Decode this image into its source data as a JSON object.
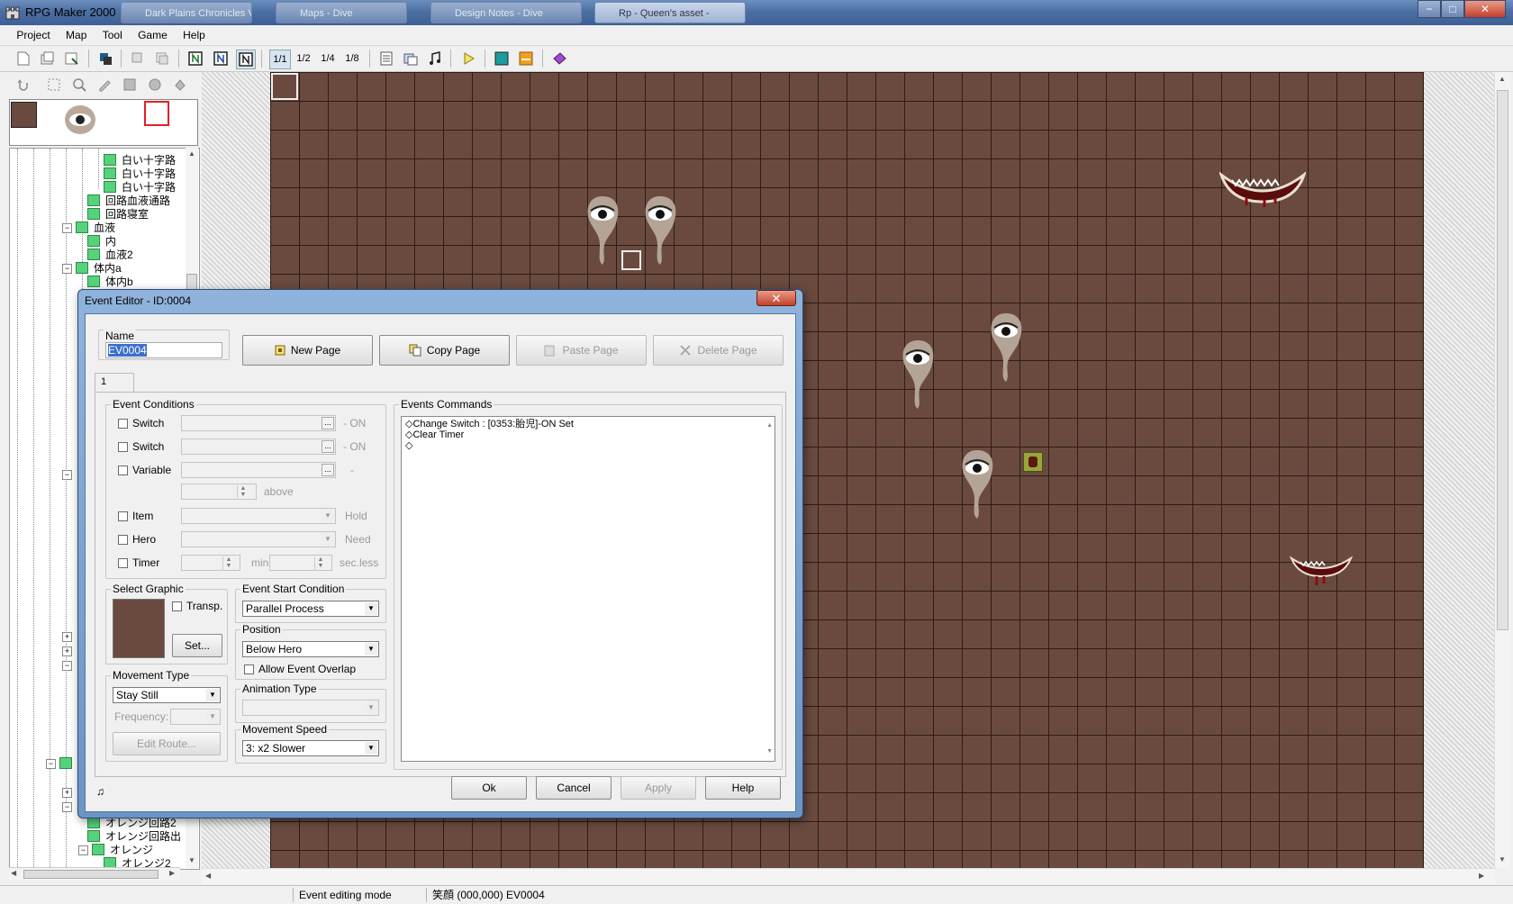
{
  "window": {
    "title": "RPG Maker 2000",
    "background_tabs": [
      "Dark Plains Chronicles Vf...",
      "Maps - Dive",
      "Design Notes - Dive",
      "Rp - Queen's asset -"
    ],
    "controls": {
      "minimize": "−",
      "maximize": "□",
      "close": "✕"
    }
  },
  "menu": [
    "Project",
    "Map",
    "Tool",
    "Game",
    "Help"
  ],
  "toolbar": {
    "layer_buttons": [
      "1/1",
      "1/2",
      "1/4",
      "1/8"
    ],
    "play_icon": "▷"
  },
  "tree": {
    "items": [
      "白い十字路",
      "白い十字路",
      "白い十字路",
      "回路血液通路",
      "回路寝室",
      "血液",
      "内",
      "血液2",
      "体内a",
      "体内b",
      "オレンジ回路2",
      "オレンジ回路出",
      "オレンジ",
      "オレンジ2"
    ]
  },
  "statusbar": {
    "mode": "Event editing mode",
    "position": "笑顔 (000,000) EV0004"
  },
  "dialog": {
    "title": "Event Editor - ID:0004",
    "close": "✕",
    "name_label": "Name",
    "name_value": "EV0004",
    "buttons": {
      "new_page": "New Page",
      "copy_page": "Copy Page",
      "paste_page": "Paste Page",
      "delete_page": "Delete Page"
    },
    "page_tab": "1",
    "conditions": {
      "label": "Event Conditions",
      "switch1": "Switch",
      "switch1_suffix": "- ON",
      "switch2": "Switch",
      "switch2_suffix": "- ON",
      "variable": "Variable",
      "variable_suffix": "-",
      "above": "above",
      "item": "Item",
      "item_suffix": "Hold",
      "hero": "Hero",
      "hero_suffix": "Need",
      "timer": "Timer",
      "timer_min": "min",
      "timer_sec": "sec.less",
      "ellipsis": "..."
    },
    "graphic": {
      "label": "Select Graphic",
      "transp": "Transp.",
      "set_button": "Set...",
      "swatch_color": "#6a4a3f"
    },
    "start_condition": {
      "label": "Event Start Condition",
      "value": "Parallel Process"
    },
    "position": {
      "label": "Position",
      "value": "Below Hero",
      "overlap": "Allow Event Overlap"
    },
    "movement_type": {
      "label": "Movement Type",
      "value": "Stay Still",
      "frequency": "Frequency:",
      "edit_route": "Edit Route..."
    },
    "animation_type": {
      "label": "Animation Type",
      "value": ""
    },
    "movement_speed": {
      "label": "Movement Speed",
      "value": "3: x2 Slower"
    },
    "commands": {
      "label": "Events Commands",
      "lines": [
        "◇Change Switch : [0353:胎児]-ON Set",
        "◇Clear Timer",
        "◇"
      ]
    },
    "footer": {
      "ok": "Ok",
      "cancel": "Cancel",
      "apply": "Apply",
      "help": "Help",
      "music_icon": "♫"
    }
  },
  "colors": {
    "map_floor": "#6a4a3f",
    "grid_line": "#2c1c16",
    "tree_folder": "#56d27b",
    "dialog_frame": "#7aa0d0"
  }
}
